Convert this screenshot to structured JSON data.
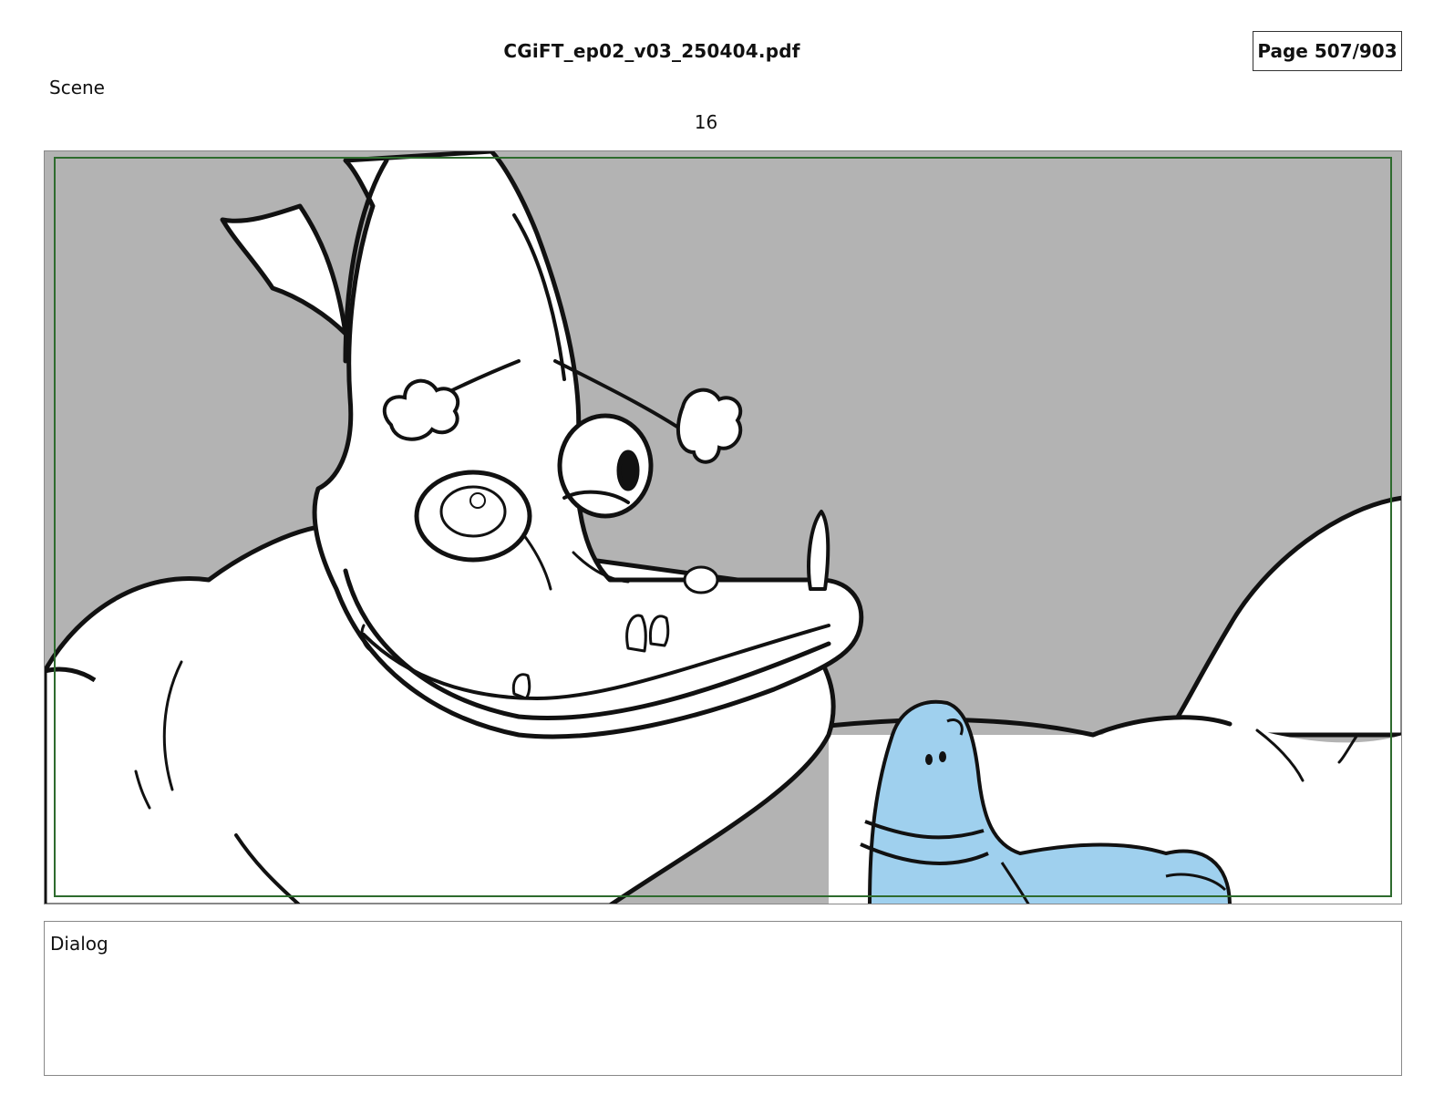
{
  "header": {
    "file_title": "CGiFT_ep02_v03_250404.pdf",
    "page_indicator": "Page 507/903"
  },
  "scene": {
    "label": "Scene",
    "number": "16"
  },
  "panel": {
    "background_color": "#b3b3b3",
    "line_color": "#111111",
    "small_character_color": "#9fd0ee",
    "safe_frame_color": "#2e6b2e"
  },
  "dialog": {
    "label": "Dialog",
    "text": ""
  }
}
